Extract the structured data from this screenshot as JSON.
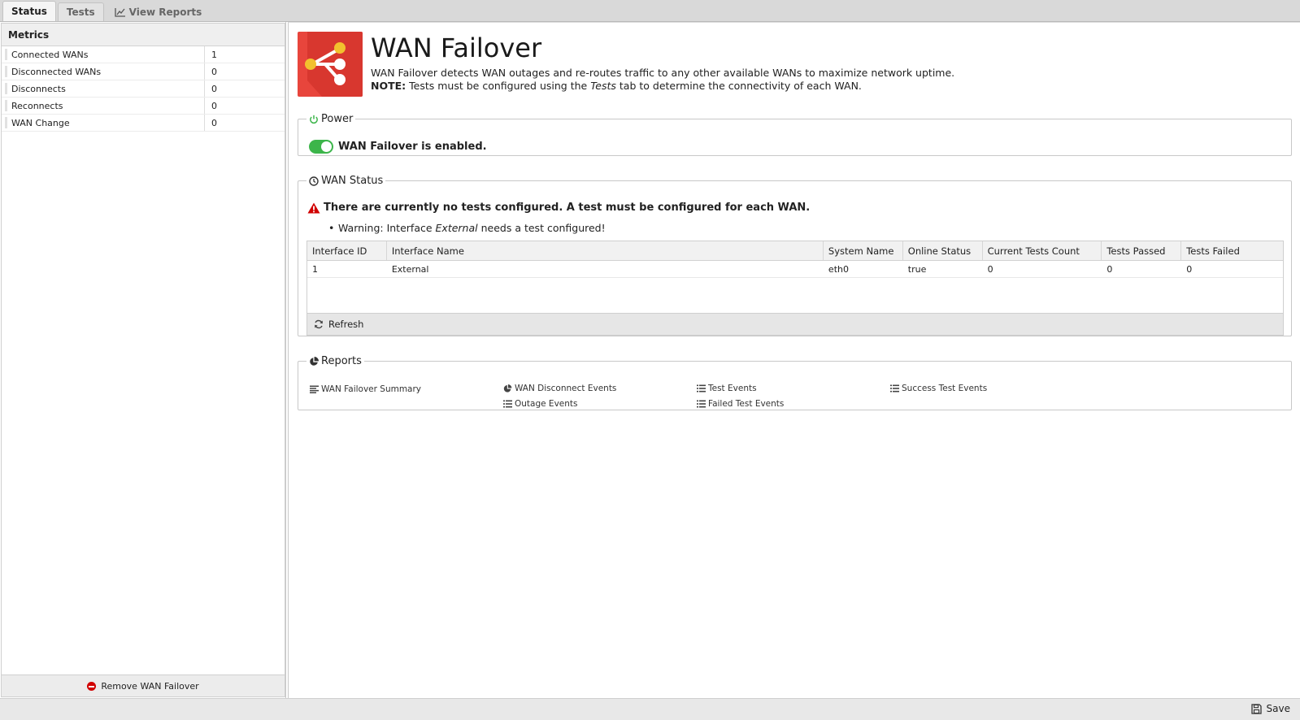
{
  "tabs": [
    {
      "label": "Status"
    },
    {
      "label": "Tests"
    },
    {
      "label": "View Reports"
    }
  ],
  "metrics": {
    "header": "Metrics",
    "rows": [
      {
        "name": "Connected WANs",
        "value": "1"
      },
      {
        "name": "Disconnected WANs",
        "value": "0"
      },
      {
        "name": "Disconnects",
        "value": "0"
      },
      {
        "name": "Reconnects",
        "value": "0"
      },
      {
        "name": "WAN Change",
        "value": "0"
      }
    ],
    "remove_label": "Remove WAN Failover"
  },
  "app": {
    "title": "WAN Failover",
    "description": "WAN Failover detects WAN outages and re-routes traffic to any other available WANs to maximize network uptime.",
    "note_label": "NOTE:",
    "note_pre": "Tests must be configured using the",
    "note_tab": "Tests",
    "note_post": "tab to determine the connectivity of each WAN."
  },
  "power": {
    "legend": "Power",
    "status_text": "WAN Failover is enabled."
  },
  "wan_status": {
    "legend": "WAN Status",
    "warning": "There are currently no tests configured. A test must be configured for each WAN.",
    "item_pre": "Warning: Interface",
    "item_iface": "External",
    "item_post": "needs a test configured!",
    "columns": [
      "Interface ID",
      "Interface Name",
      "System Name",
      "Online Status",
      "Current Tests Count",
      "Tests Passed",
      "Tests Failed"
    ],
    "rows": [
      [
        "1",
        "External",
        "eth0",
        "true",
        "0",
        "0",
        "0"
      ]
    ],
    "refresh_label": "Refresh"
  },
  "reports": {
    "legend": "Reports",
    "links": [
      {
        "label": "WAN Failover Summary"
      },
      {
        "label": "WAN Disconnect Events"
      },
      {
        "label": "Outage Events"
      },
      {
        "label": "Test Events"
      },
      {
        "label": "Failed Test Events"
      },
      {
        "label": "Success Test Events"
      }
    ]
  },
  "footer": {
    "save_label": "Save"
  },
  "colors": {
    "accent_green": "#3cb54a",
    "icon_red": "#e8453c",
    "warning_red": "#d10000"
  }
}
